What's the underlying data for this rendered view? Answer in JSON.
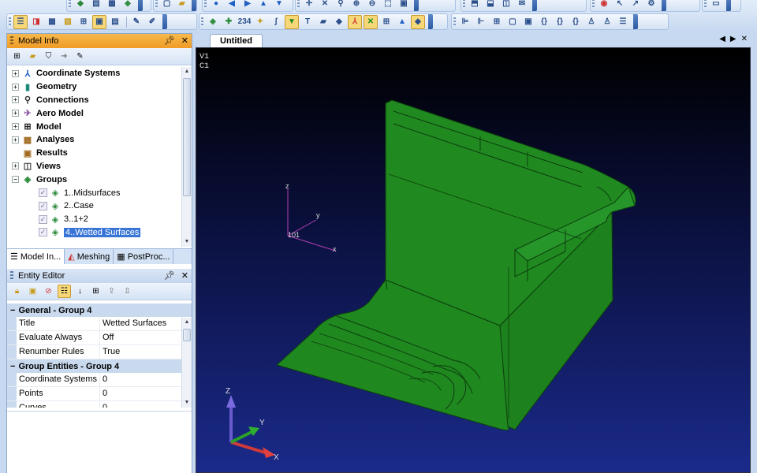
{
  "toolbar": {
    "row1_icons": [
      "new-icon",
      "open-icon",
      "save-icon",
      "print-icon",
      "copy-icon",
      "paste-icon",
      "view-icon",
      "undo-icon",
      "redo-icon",
      "pan-icon",
      "zoom-icon",
      "rotate-icon",
      "fit-icon",
      "select-icon"
    ],
    "row2_icons": [
      "model-info-icon",
      "entity-editor-icon",
      "meshing-icon",
      "postproc-icon",
      "grid-icon",
      "layers-icon",
      "color-icon",
      "edit-icon",
      "tool-icon",
      "align-icon",
      "grid-icon",
      "box-icon",
      "bracket-icon",
      "expand-icon"
    ]
  },
  "model_info": {
    "title": "Model Info",
    "pin_icon": "pin-icon",
    "close_label": "✕",
    "tree": [
      {
        "label": "Coordinate Systems",
        "icon": "axes-icon",
        "level": 0,
        "expander": "+"
      },
      {
        "label": "Geometry",
        "icon": "cylinder-icon",
        "level": 0,
        "expander": "+"
      },
      {
        "label": "Connections",
        "icon": "connection-icon",
        "level": 0,
        "expander": "+"
      },
      {
        "label": "Aero Model",
        "icon": "aero-icon",
        "level": 0,
        "expander": "+"
      },
      {
        "label": "Model",
        "icon": "grid-icon",
        "level": 0,
        "expander": "+"
      },
      {
        "label": "Analyses",
        "icon": "analysis-icon",
        "level": 0,
        "expander": "+"
      },
      {
        "label": "Results",
        "icon": "results-icon",
        "level": 0,
        "expander": ""
      },
      {
        "label": "Views",
        "icon": "views-icon",
        "level": 0,
        "expander": "+"
      },
      {
        "label": "Groups",
        "icon": "groups-icon",
        "level": 0,
        "expander": "−"
      },
      {
        "label": "1..Midsurfaces",
        "icon": "group-icon",
        "level": 1,
        "expander": ""
      },
      {
        "label": "2..Case",
        "icon": "group-icon",
        "level": 1,
        "expander": ""
      },
      {
        "label": "3..1+2",
        "icon": "group-icon",
        "level": 1,
        "expander": ""
      },
      {
        "label": "4..Wetted Surfaces",
        "icon": "group-icon",
        "level": 1,
        "expander": "",
        "selected": true
      }
    ],
    "tabs": [
      "Model In...",
      "Meshing",
      "PostProc..."
    ]
  },
  "entity_editor": {
    "title": "Entity Editor",
    "categories": [
      {
        "label": "General - Group 4",
        "rows": [
          {
            "name": "Title",
            "value": "Wetted Surfaces"
          },
          {
            "name": "Evaluate Always",
            "value": "Off"
          },
          {
            "name": "Renumber Rules",
            "value": "True"
          }
        ]
      },
      {
        "label": "Group Entities - Group 4",
        "rows": [
          {
            "name": "Coordinate Systems",
            "value": "0"
          },
          {
            "name": "Points",
            "value": "0"
          },
          {
            "name": "Curves",
            "value": "0"
          }
        ]
      }
    ]
  },
  "document": {
    "tab_title": "Untitled",
    "view_label": "V1",
    "csys_label": "C1",
    "csys_id": "101",
    "axis_x": "x",
    "axis_y": "y",
    "axis_z": "z",
    "triad_x": "X",
    "triad_y": "Y",
    "triad_z": "Z"
  },
  "colors": {
    "model_green": "#1f8a1f",
    "model_edge": "#0d3d0d",
    "selection": "#3875d7",
    "panel_header": "#f4a93a"
  }
}
